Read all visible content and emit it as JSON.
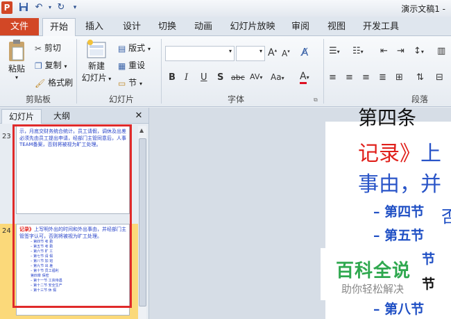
{
  "window": {
    "title": "演示文稿1 -",
    "app_icon": "P"
  },
  "tabs": {
    "file": "文件",
    "items": [
      "开始",
      "插入",
      "设计",
      "切换",
      "动画",
      "幻灯片放映",
      "审阅",
      "视图",
      "开发工具"
    ]
  },
  "clipboard": {
    "paste": "粘贴",
    "cut": "剪切",
    "copy": "复制",
    "format_painter": "格式刷",
    "label": "剪贴板"
  },
  "slides_group": {
    "new_slide_line1": "新建",
    "new_slide_line2": "幻灯片",
    "layout": "版式",
    "reset": "重设",
    "section": "节",
    "label": "幻灯片"
  },
  "font": {
    "label": "字体",
    "bold": "B",
    "italic": "I",
    "underline": "U",
    "shadow": "S",
    "strike": "abc",
    "spacing": "AV",
    "case": "Aa",
    "color": "A"
  },
  "paragraph": {
    "label": "段落"
  },
  "pane": {
    "tab_slides": "幻灯片",
    "tab_outline": "大纲",
    "close": "✕",
    "slide23": {
      "number": "23",
      "text": "示，月底交财务统合统计。员工请假，调休及出差必须先由员工提出申请，经部门主管同意后，人事TEAM备案，否则将被视为旷工处理。"
    },
    "slide24": {
      "number": "24",
      "red": "记录》",
      "text": "上写明外出的时间和外出事由，并经部门主管签字认可，否则将被视为旷工处理。",
      "lines": [
        "– 第四节 考 勤",
        "– 第五节 考 勤",
        "– 第六节 旷 工",
        "– 第七节 请 假",
        "– 第八节 加 班",
        "– 第九节 出 差",
        "– 第十节 员工福利",
        "第四章 保密",
        "– 第十一节 工资待遇",
        "– 第十二节 安全生产",
        "– 第十三节 休 假"
      ]
    }
  },
  "slide": {
    "top_partial": "第四条",
    "line1_red": "记录》",
    "line1_rest": "上",
    "line2": "事由，并",
    "bullets": [
      "– 第四节",
      "– 第五节",
      "节",
      "节",
      "– 第八节"
    ],
    "partial_right": "否"
  },
  "watermark": {
    "main": "百科全说",
    "sub": "助你轻松解决"
  },
  "colors": {
    "file_tab": "#d24726",
    "red": "#e0201b",
    "blue": "#2a55c8",
    "bullet_blue": "#1f4fc4"
  }
}
